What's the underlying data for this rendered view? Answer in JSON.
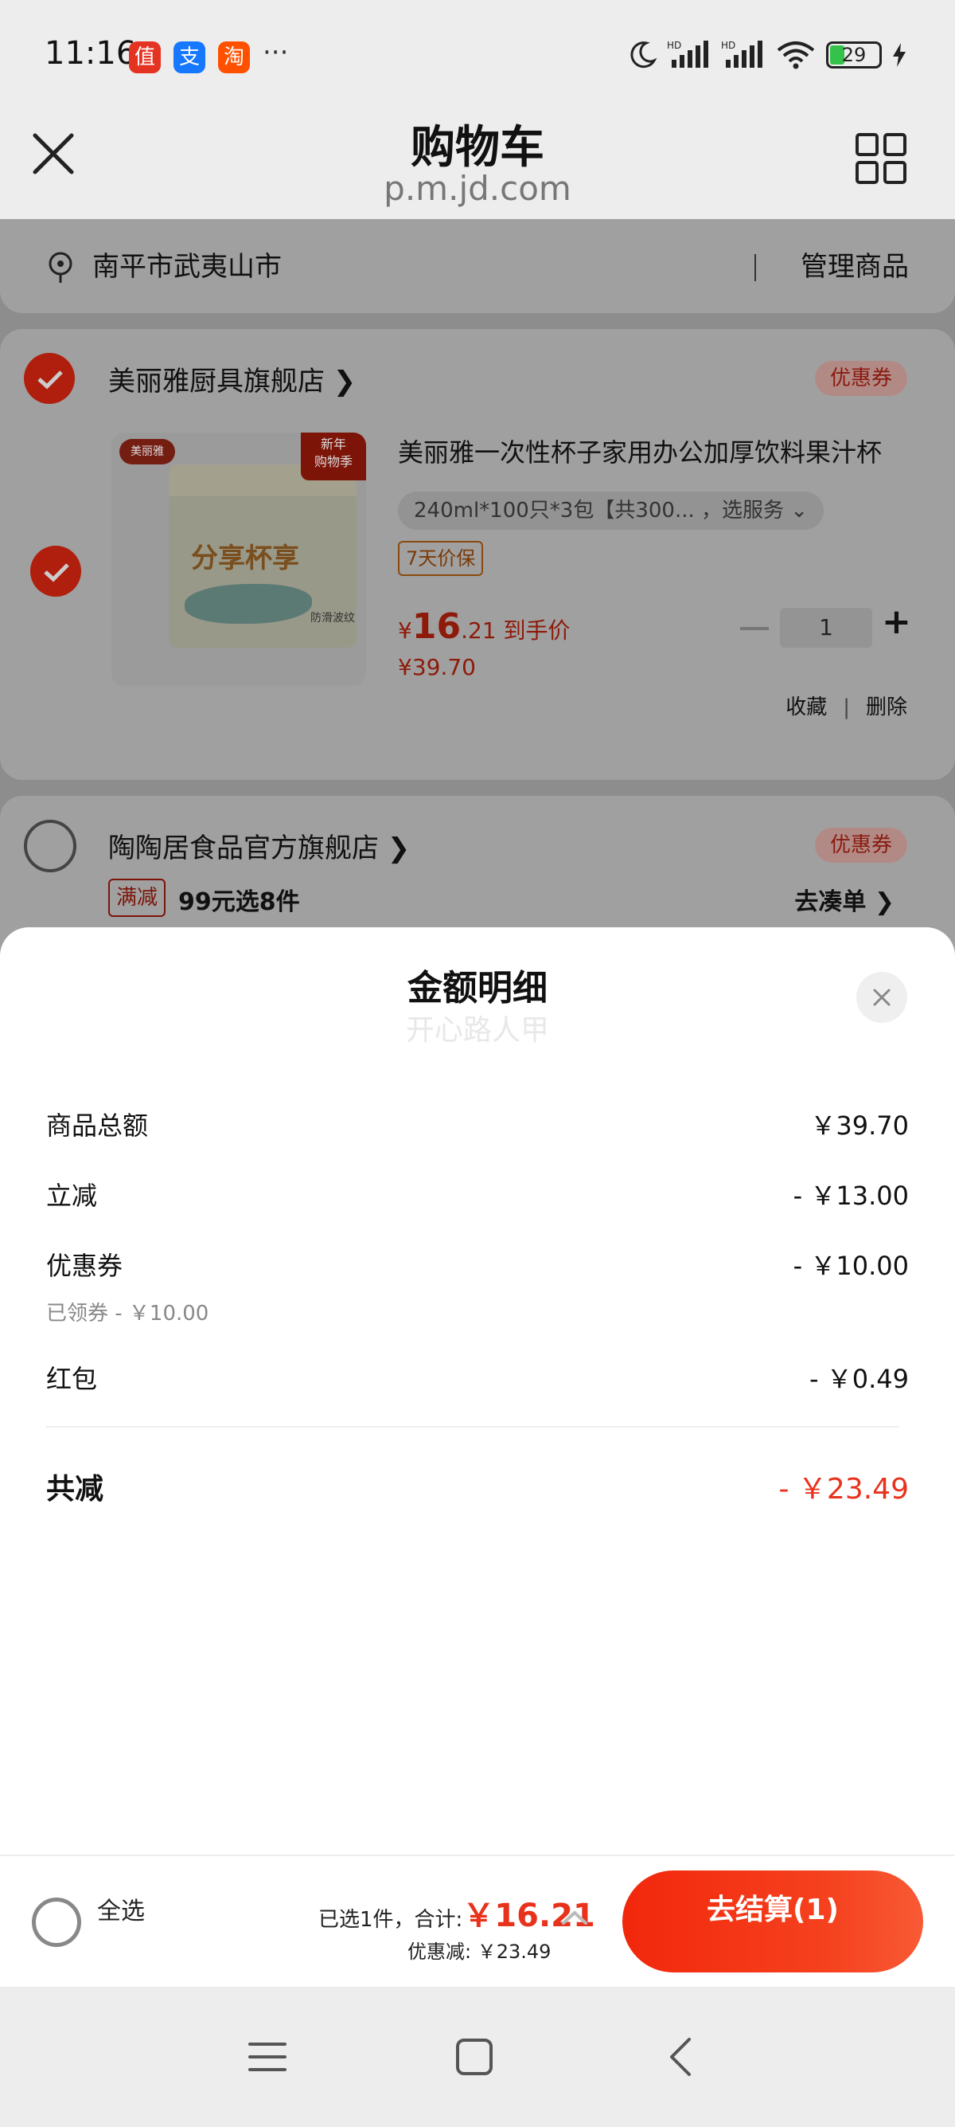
{
  "status_bar": {
    "time": "11:16",
    "apps": [
      {
        "name": "值",
        "color": "#e53322"
      },
      {
        "name": "支",
        "color": "#1677ff"
      },
      {
        "name": "淘",
        "color": "#ff5000"
      }
    ],
    "more": "···",
    "battery": "29"
  },
  "header": {
    "title": "购物车",
    "subtitle": "p.m.jd.com"
  },
  "address": {
    "location": "南平市武夷山市",
    "manage_label": "管理商品"
  },
  "store1": {
    "name": "美丽雅厨具旗舰店 ❯",
    "coupon_tag": "优惠券",
    "product": {
      "image_brand": "美丽雅",
      "image_corner_line1": "新年",
      "image_corner_line2": "购物季",
      "image_label": "分享杯享",
      "image_line": "防滑波纹",
      "title": "美丽雅一次性杯子家用办公加厚饮料果汁杯",
      "spec": "240ml*100只*3包【共300... ，选服务 ⌄",
      "badge": "7天价保",
      "price_symbol": "¥",
      "price_int": "16",
      "price_dec": ".21 到手价",
      "old_price": "¥39.70",
      "quantity": "1",
      "fav_label": "收藏",
      "delete_label": "删除"
    }
  },
  "store2": {
    "name": "陶陶居食品官方旗舰店 ❯",
    "coupon_tag": "优惠券",
    "promo_tag": "满减",
    "promo_text": "99元选8件",
    "promo_link": "去凑单 ❯"
  },
  "sheet": {
    "title": "金额明细",
    "watermark": "开心路人甲",
    "rows": [
      {
        "label": "商品总额",
        "value": "￥39.70"
      },
      {
        "label": "立减",
        "value": "- ￥13.00"
      },
      {
        "label": "优惠券",
        "value": "- ￥10.00",
        "sub": "已领券 - ￥10.00"
      },
      {
        "label": "红包",
        "value": "- ￥0.49"
      }
    ],
    "total_label": "共减",
    "total_value": "- ￥23.49"
  },
  "checkout": {
    "select_all": "全选",
    "summary_prefix": "已选1件，合计:",
    "summary_amount": "￥16.21",
    "discount": "优惠减: ￥23.49",
    "button": "去结算(1)"
  },
  "colors": {
    "brand_red": "#e8321c",
    "button_red": "#f2270c"
  }
}
